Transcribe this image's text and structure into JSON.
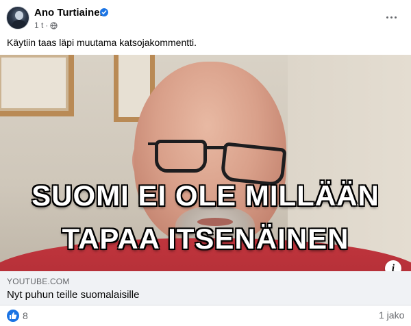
{
  "post": {
    "author": "Ano Turtiainen",
    "time": "1 t",
    "separator": "·",
    "text": "Käytiin taas läpi muutama katsojakommentti."
  },
  "video": {
    "overlay_line1": "SUOMI EI OLE MILLÄÄN",
    "overlay_line2": "TAPAA ITSENÄINEN",
    "info_label": "i"
  },
  "link": {
    "domain": "YOUTUBE.COM",
    "title": "Nyt puhun teille suomalaisille"
  },
  "footer": {
    "reaction_count": "8",
    "shares": "1 jako"
  },
  "colors": {
    "accent": "#1b74e4",
    "shirt": "#b02e36",
    "muted_text": "#65676b"
  },
  "icons": [
    "verified-badge-icon",
    "globe-icon",
    "more-options-icon",
    "info-icon",
    "like-reaction-icon"
  ]
}
